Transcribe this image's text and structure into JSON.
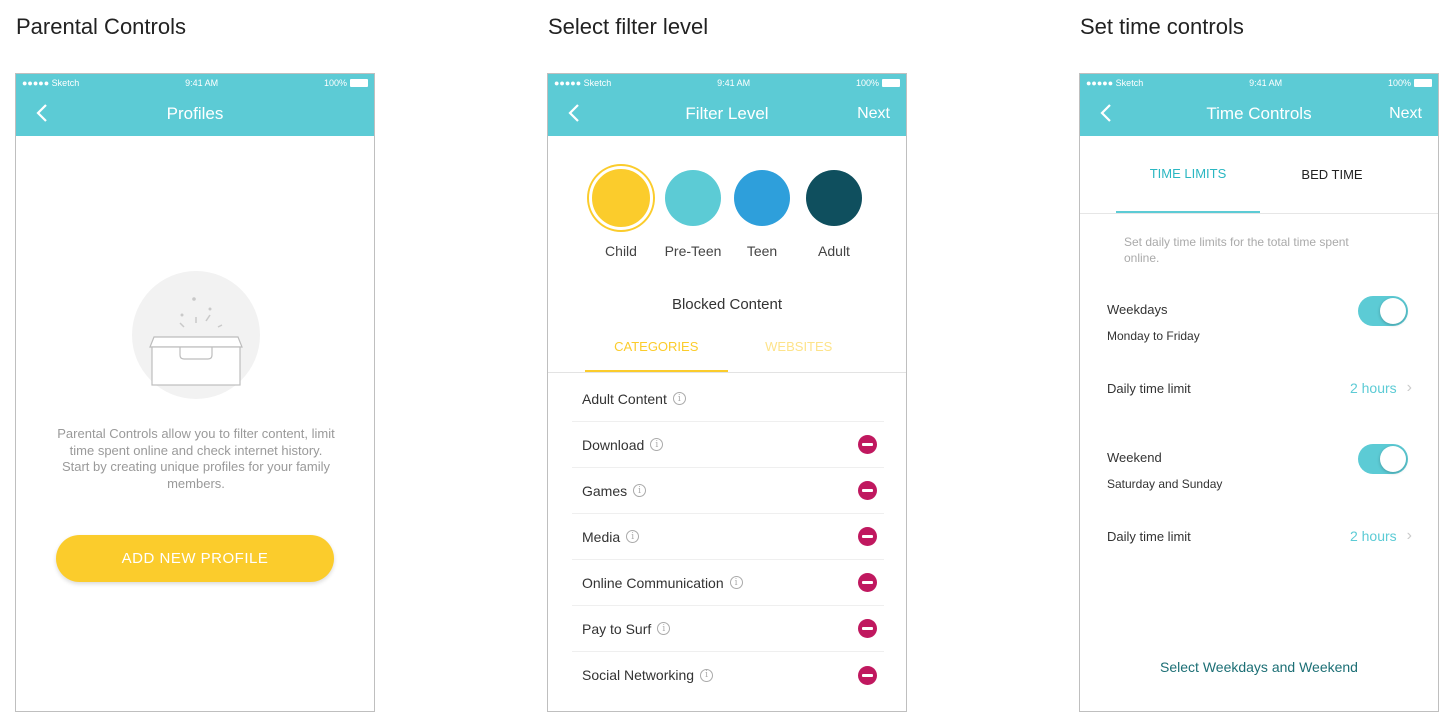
{
  "titles": {
    "parental": "Parental Controls",
    "filter": "Select filter level",
    "time": "Set time controls"
  },
  "status_bar": {
    "carrier": "●●●●● Sketch",
    "time": "9:41 AM",
    "battery": "100%"
  },
  "profiles": {
    "nav_title": "Profiles",
    "description": "Parental Controls allow you to filter content, limit time spent online and check internet history. Start by creating unique profiles for your family members.",
    "add_button": "ADD NEW PROFILE"
  },
  "filter_level": {
    "nav_title": "Filter Level",
    "next": "Next",
    "levels": [
      {
        "label": "Child",
        "color": "#fbcc2c",
        "selected": true
      },
      {
        "label": "Pre-Teen",
        "color": "#5ccbd5",
        "selected": false
      },
      {
        "label": "Teen",
        "color": "#2e9fdb",
        "selected": false
      },
      {
        "label": "Adult",
        "color": "#0f4f5e",
        "selected": false
      }
    ],
    "blocked_title": "Blocked Content",
    "tabs": [
      "CATEGORIES",
      "WEBSITES"
    ],
    "categories": [
      {
        "label": "Adult Content",
        "blocked": false
      },
      {
        "label": "Download",
        "blocked": true
      },
      {
        "label": "Games",
        "blocked": true
      },
      {
        "label": "Media",
        "blocked": true
      },
      {
        "label": "Online Communication",
        "blocked": true
      },
      {
        "label": "Pay to Surf",
        "blocked": true
      },
      {
        "label": "Social Networking",
        "blocked": true
      }
    ]
  },
  "time_controls": {
    "nav_title": "Time Controls",
    "next": "Next",
    "tabs": [
      "TIME LIMITS",
      "BED TIME"
    ],
    "description": "Set daily time limits for the total time spent online.",
    "weekdays": {
      "title": "Weekdays",
      "subtitle": "Monday to Friday",
      "limit_label": "Daily time limit",
      "limit_value": "2 hours",
      "enabled": true
    },
    "weekend": {
      "title": "Weekend",
      "subtitle": "Saturday and Sunday",
      "limit_label": "Daily time limit",
      "limit_value": "2 hours",
      "enabled": true
    },
    "select_link": "Select Weekdays and Weekend"
  }
}
